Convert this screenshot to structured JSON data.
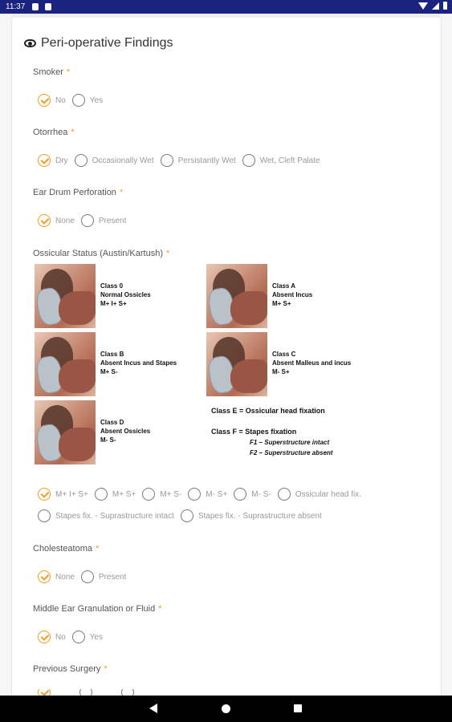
{
  "status_bar": {
    "time": "11:37"
  },
  "section": {
    "title": "Peri-operative Findings"
  },
  "questions": {
    "smoker": {
      "label": "Smoker",
      "required": "*",
      "options": [
        "No",
        "Yes"
      ],
      "selected": "No"
    },
    "otorrhea": {
      "label": "Otorrhea",
      "required": "*",
      "options": [
        "Dry",
        "Occasionally Wet",
        "Persistantly Wet",
        "Wet, Cleft Palate"
      ],
      "selected": "Dry"
    },
    "perforation": {
      "label": "Ear Drum Perforation",
      "required": "*",
      "options": [
        "None",
        "Present"
      ],
      "selected": "None"
    },
    "ossicular": {
      "label": "Ossicular Status (Austin/Kartush)",
      "required": "*",
      "options_row1": [
        "M+ I+ S+",
        "M+ S+",
        "M+ S-",
        "M- S+",
        "M- S-",
        "Ossicular head fix."
      ],
      "options_row2": [
        "Stapes fix. - Suprastructure intact",
        "Stapes fix. - Suprastructure absent"
      ],
      "selected": "M+ I+ S+"
    },
    "cholesteatoma": {
      "label": "Cholesteatoma",
      "required": "*",
      "options": [
        "None",
        "Present"
      ],
      "selected": "None"
    },
    "granulation": {
      "label": "Middle Ear Granulation or Fluid",
      "required": "*",
      "options": [
        "No",
        "Yes"
      ],
      "selected": "No"
    },
    "previous_surgery": {
      "label": "Previous Surgery",
      "required": "*"
    }
  },
  "figure": {
    "class0": "Class 0\nNormal Ossicles\nM+ I+ S+",
    "classA": "Class A\nAbsent Incus\nM+ S+",
    "classB": "Class B\nAbsent Incus and Stapes\nM+ S-",
    "classC": "Class C\nAbsent Malleus and incus\nM- S+",
    "classD": "Class D\nAbsent Ossicles\nM- S-",
    "classE": "Class E = Ossicular head fixation",
    "classF": "Class F = Stapes fixation",
    "f1": "F1 – Superstructure intact",
    "f2": "F2 – Superstructure absent"
  },
  "icons": {
    "section": "eye-icon"
  },
  "colors": {
    "accent": "#f29c1f",
    "status_bar": "#1a237e"
  }
}
